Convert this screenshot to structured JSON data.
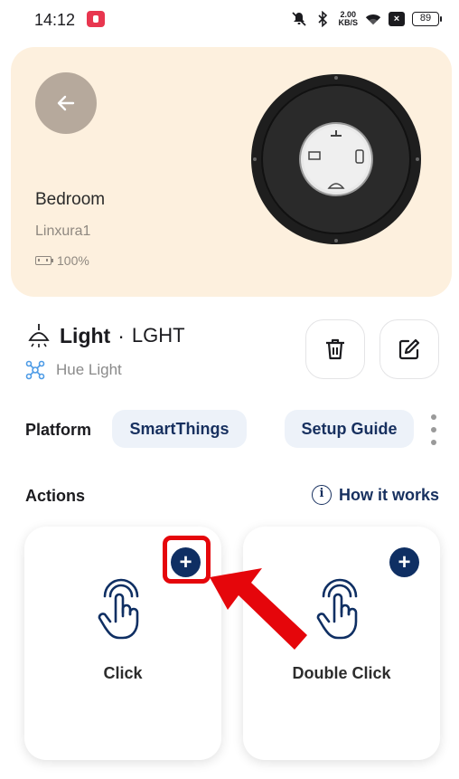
{
  "status_bar": {
    "time": "14:12",
    "net_speed_top": "2.00",
    "net_speed_bottom": "KB/S",
    "battery": "89",
    "icons": [
      "screen-record-icon",
      "mute-icon",
      "bluetooth-icon",
      "wifi-icon",
      "notification-x-icon"
    ]
  },
  "header": {
    "room": "Bedroom",
    "device_id": "Linxura1",
    "battery": "100%",
    "back_icon": "arrow-left-icon",
    "accent": "#fdf0de"
  },
  "device": {
    "icon": "ceiling-light-icon",
    "name": "Light",
    "separator": "·",
    "code": "LGHT",
    "source_icon": "hue-network-icon",
    "source": "Hue Light"
  },
  "buttons": {
    "delete_icon": "trash-icon",
    "edit_icon": "edit-icon"
  },
  "platform": {
    "label": "Platform",
    "value": "SmartThings",
    "guide": "Setup Guide",
    "more_icon": "more-vertical-icon"
  },
  "actions": {
    "label": "Actions",
    "how_it_works": "How it works",
    "info_icon": "info-icon",
    "cards": [
      {
        "label": "Click",
        "icon": "tap-hand-icon",
        "add": "+"
      },
      {
        "label": "Double Click",
        "icon": "tap-hand-icon",
        "add": "+"
      }
    ]
  },
  "colors": {
    "primary_navy": "#0f2f63",
    "pill_bg": "#edf2f9",
    "annotation_red": "#e5060b"
  }
}
